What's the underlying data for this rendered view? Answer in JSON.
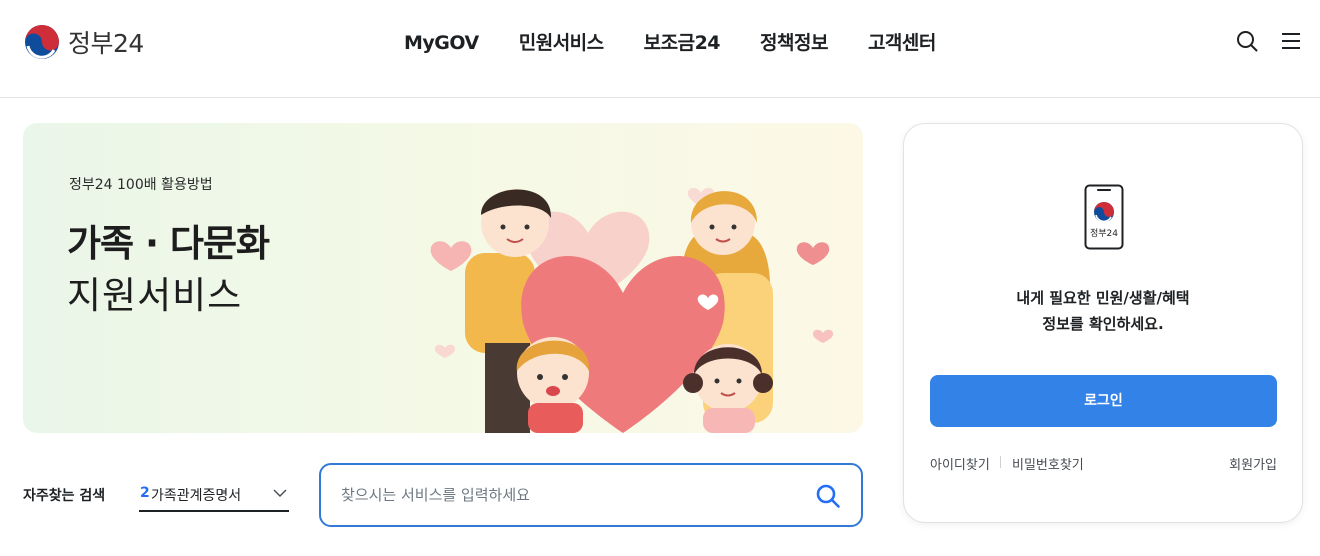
{
  "header": {
    "logo_text": "정부24",
    "nav": [
      "MyGOV",
      "민원서비스",
      "보조금24",
      "정책정보",
      "고객센터"
    ]
  },
  "banner": {
    "subtitle": "정부24 100배 활용방법",
    "title_line1": "가족 · 다문화",
    "title_line2": "지원서비스"
  },
  "frequent_search": {
    "label": "자주찾는 검색",
    "rank": "2",
    "selected": "가족관계증명서"
  },
  "search": {
    "placeholder": "찾으시는 서비스를 입력하세요"
  },
  "login_card": {
    "phone_label": "정부24",
    "message_line1": "내게 필요한 민원/생활/혜택",
    "message_line2": "정보를 확인하세요.",
    "login_button": "로그인",
    "find_id": "아이디찾기",
    "find_password": "비밀번호찾기",
    "join": "회원가입"
  },
  "colors": {
    "accent": "#3282e8",
    "search_border": "#3379d6",
    "emblem_red": "#cd2e3a",
    "emblem_blue": "#0f4c9c"
  }
}
